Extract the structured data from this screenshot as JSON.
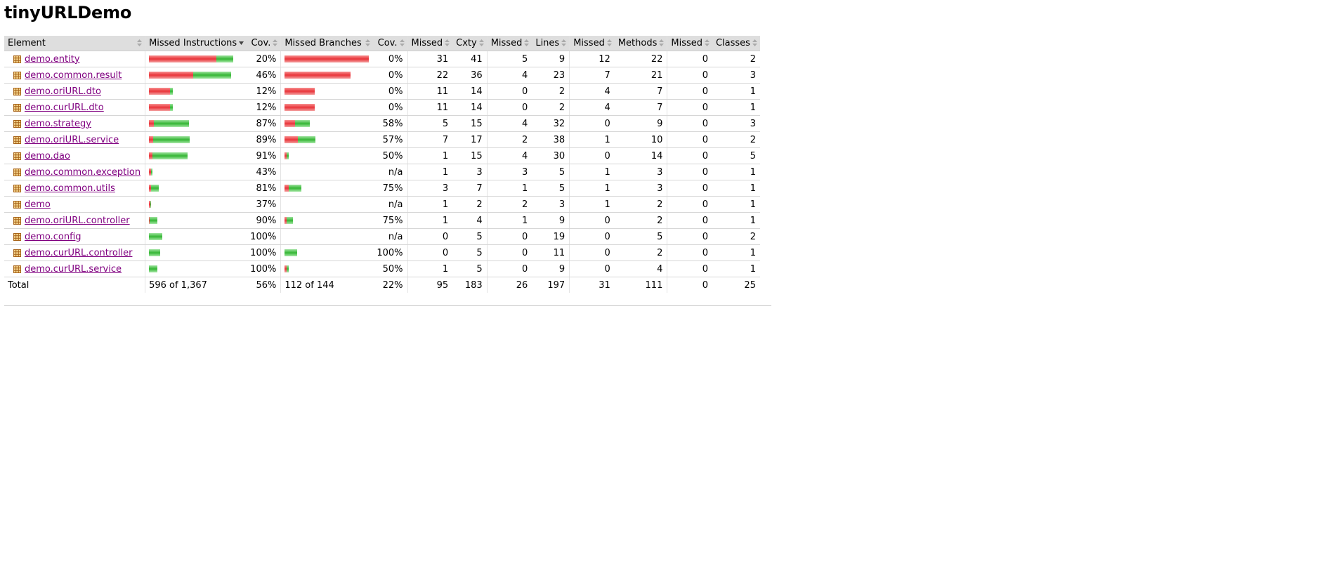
{
  "page": {
    "title": "tinyURLDemo"
  },
  "colors": {
    "missed": "#e9343a",
    "covered": "#35b635",
    "link": "#800080",
    "header_bg": "#dedede"
  },
  "icons": {
    "package": "package-icon",
    "sort": "sort-icon",
    "sort_down": "sort-down-icon"
  },
  "table": {
    "headers": [
      {
        "label": "Element",
        "sorted": false
      },
      {
        "label": "Missed Instructions",
        "sorted": true
      },
      {
        "label": "Cov.",
        "sorted": false
      },
      {
        "label": "Missed Branches",
        "sorted": false
      },
      {
        "label": "Cov.",
        "sorted": false
      },
      {
        "label": "Missed",
        "sorted": false
      },
      {
        "label": "Cxty",
        "sorted": false
      },
      {
        "label": "Missed",
        "sorted": false
      },
      {
        "label": "Lines",
        "sorted": false
      },
      {
        "label": "Missed",
        "sorted": false
      },
      {
        "label": "Methods",
        "sorted": false
      },
      {
        "label": "Missed",
        "sorted": false
      },
      {
        "label": "Classes",
        "sorted": false
      }
    ],
    "rows": [
      {
        "element": "demo.entity",
        "instr_missed_frac": 0.8,
        "instr_covered_frac": 0.2,
        "instr_cov": "20%",
        "br_missed_frac": 1.0,
        "br_covered_frac": 0.0,
        "br_cov": "0%",
        "cxty_missed": "31",
        "cxty": "41",
        "lines_missed": "5",
        "lines": "9",
        "methods_missed": "12",
        "methods": "22",
        "classes_missed": "0",
        "classes": "2"
      },
      {
        "element": "demo.common.result",
        "instr_missed_frac": 0.54,
        "instr_covered_frac": 0.46,
        "instr_cov": "46%",
        "br_missed_frac": 1.0,
        "br_covered_frac": 0.0,
        "br_cov": "0%",
        "cxty_missed": "22",
        "cxty": "36",
        "lines_missed": "4",
        "lines": "23",
        "methods_missed": "7",
        "methods": "21",
        "classes_missed": "0",
        "classes": "3"
      },
      {
        "element": "demo.oriURL.dto",
        "instr_missed_frac": 0.88,
        "instr_covered_frac": 0.12,
        "instr_cov": "12%",
        "br_missed_frac": 1.0,
        "br_covered_frac": 0.0,
        "br_cov": "0%",
        "cxty_missed": "11",
        "cxty": "14",
        "lines_missed": "0",
        "lines": "2",
        "methods_missed": "4",
        "methods": "7",
        "classes_missed": "0",
        "classes": "1"
      },
      {
        "element": "demo.curURL.dto",
        "instr_missed_frac": 0.88,
        "instr_covered_frac": 0.12,
        "instr_cov": "12%",
        "br_missed_frac": 1.0,
        "br_covered_frac": 0.0,
        "br_cov": "0%",
        "cxty_missed": "11",
        "cxty": "14",
        "lines_missed": "0",
        "lines": "2",
        "methods_missed": "4",
        "methods": "7",
        "classes_missed": "0",
        "classes": "1"
      },
      {
        "element": "demo.strategy",
        "instr_missed_frac": 0.13,
        "instr_covered_frac": 0.87,
        "instr_cov": "87%",
        "br_missed_frac": 0.42,
        "br_covered_frac": 0.58,
        "br_cov": "58%",
        "cxty_missed": "5",
        "cxty": "15",
        "lines_missed": "4",
        "lines": "32",
        "methods_missed": "0",
        "methods": "9",
        "classes_missed": "0",
        "classes": "3"
      },
      {
        "element": "demo.oriURL.service",
        "instr_missed_frac": 0.11,
        "instr_covered_frac": 0.89,
        "instr_cov": "89%",
        "br_missed_frac": 0.43,
        "br_covered_frac": 0.57,
        "br_cov": "57%",
        "cxty_missed": "7",
        "cxty": "17",
        "lines_missed": "2",
        "lines": "38",
        "methods_missed": "1",
        "methods": "10",
        "classes_missed": "0",
        "classes": "2"
      },
      {
        "element": "demo.dao",
        "instr_missed_frac": 0.09,
        "instr_covered_frac": 0.91,
        "instr_cov": "91%",
        "br_missed_frac": 0.5,
        "br_covered_frac": 0.5,
        "br_cov": "50%",
        "cxty_missed": "1",
        "cxty": "15",
        "lines_missed": "4",
        "lines": "30",
        "methods_missed": "0",
        "methods": "14",
        "classes_missed": "0",
        "classes": "5"
      },
      {
        "element": "demo.common.exception",
        "instr_missed_frac": 0.57,
        "instr_covered_frac": 0.43,
        "instr_cov": "43%",
        "br_missed_frac": 0,
        "br_covered_frac": 0,
        "br_cov": "n/a",
        "cxty_missed": "1",
        "cxty": "3",
        "lines_missed": "3",
        "lines": "5",
        "methods_missed": "1",
        "methods": "3",
        "classes_missed": "0",
        "classes": "1"
      },
      {
        "element": "demo.common.utils",
        "instr_missed_frac": 0.19,
        "instr_covered_frac": 0.81,
        "instr_cov": "81%",
        "br_missed_frac": 0.25,
        "br_covered_frac": 0.75,
        "br_cov": "75%",
        "cxty_missed": "3",
        "cxty": "7",
        "lines_missed": "1",
        "lines": "5",
        "methods_missed": "1",
        "methods": "3",
        "classes_missed": "0",
        "classes": "1"
      },
      {
        "element": "demo",
        "instr_missed_frac": 0.63,
        "instr_covered_frac": 0.37,
        "instr_cov": "37%",
        "br_missed_frac": 0,
        "br_covered_frac": 0,
        "br_cov": "n/a",
        "cxty_missed": "1",
        "cxty": "2",
        "lines_missed": "2",
        "lines": "3",
        "methods_missed": "1",
        "methods": "2",
        "classes_missed": "0",
        "classes": "1"
      },
      {
        "element": "demo.oriURL.controller",
        "instr_missed_frac": 0.1,
        "instr_covered_frac": 0.9,
        "instr_cov": "90%",
        "br_missed_frac": 0.25,
        "br_covered_frac": 0.75,
        "br_cov": "75%",
        "cxty_missed": "1",
        "cxty": "4",
        "lines_missed": "1",
        "lines": "9",
        "methods_missed": "0",
        "methods": "2",
        "classes_missed": "0",
        "classes": "1"
      },
      {
        "element": "demo.config",
        "instr_missed_frac": 0.0,
        "instr_covered_frac": 1.0,
        "instr_cov": "100%",
        "br_missed_frac": 0,
        "br_covered_frac": 0,
        "br_cov": "n/a",
        "cxty_missed": "0",
        "cxty": "5",
        "lines_missed": "0",
        "lines": "19",
        "methods_missed": "0",
        "methods": "5",
        "classes_missed": "0",
        "classes": "2"
      },
      {
        "element": "demo.curURL.controller",
        "instr_missed_frac": 0.0,
        "instr_covered_frac": 1.0,
        "instr_cov": "100%",
        "br_missed_frac": 0.0,
        "br_covered_frac": 1.0,
        "br_cov": "100%",
        "cxty_missed": "0",
        "cxty": "5",
        "lines_missed": "0",
        "lines": "11",
        "methods_missed": "0",
        "methods": "2",
        "classes_missed": "0",
        "classes": "1"
      },
      {
        "element": "demo.curURL.service",
        "instr_missed_frac": 0.0,
        "instr_covered_frac": 1.0,
        "instr_cov": "100%",
        "br_missed_frac": 0.5,
        "br_covered_frac": 0.5,
        "br_cov": "50%",
        "cxty_missed": "1",
        "cxty": "5",
        "lines_missed": "0",
        "lines": "9",
        "methods_missed": "0",
        "methods": "4",
        "classes_missed": "0",
        "classes": "1"
      }
    ],
    "instr_scale": [
      1.0,
      0.97,
      0.28,
      0.28,
      0.48,
      0.49,
      0.46,
      0.04,
      0.11,
      0.02,
      0.1,
      0.16,
      0.13,
      0.1
    ],
    "br_scale": [
      1.0,
      0.78,
      0.36,
      0.36,
      0.3,
      0.36,
      0.05,
      0,
      0.2,
      0,
      0.1,
      0,
      0.15,
      0.05
    ],
    "total": {
      "label": "Total",
      "instr": "596 of 1,367",
      "instr_cov": "56%",
      "br": "112 of 144",
      "br_cov": "22%",
      "cxty_missed": "95",
      "cxty": "183",
      "lines_missed": "26",
      "lines": "197",
      "methods_missed": "31",
      "methods": "111",
      "classes_missed": "0",
      "classes": "25"
    }
  }
}
